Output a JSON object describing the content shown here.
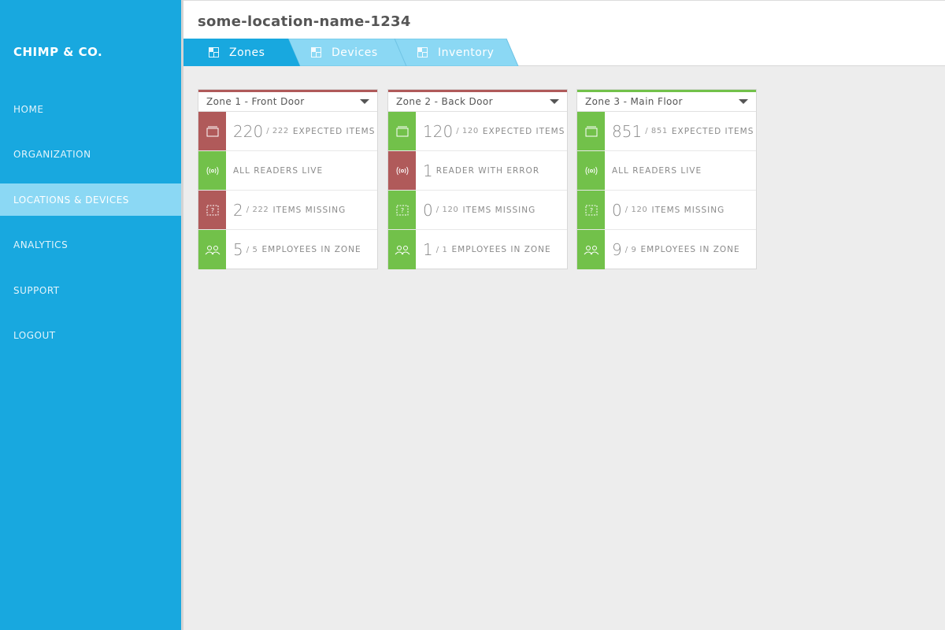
{
  "brand": "CHIMP & CO.",
  "nav": [
    {
      "label": "HOME",
      "active": false
    },
    {
      "label": "ORGANIZATION",
      "active": false
    },
    {
      "label": "LOCATIONS & DEVICES",
      "active": true
    },
    {
      "label": "ANALYTICS",
      "active": false
    },
    {
      "label": "SUPPORT",
      "active": false
    },
    {
      "label": "LOGOUT",
      "active": false
    }
  ],
  "page_title": "some-location-name-1234",
  "tabs": [
    {
      "label": "Zones",
      "active": true
    },
    {
      "label": "Devices",
      "active": false
    },
    {
      "label": "Inventory",
      "active": false
    }
  ],
  "colors": {
    "sidebar": "#18a8df",
    "active_nav": "#8bd8f4",
    "red": "#b05a5a",
    "green": "#72c14a"
  },
  "zones": [
    {
      "name": "Zone 1 - Front Door",
      "status": "red",
      "items": {
        "count": "220",
        "total": "/ 222",
        "label": "EXPECTED ITEMS",
        "status": "red"
      },
      "readers": {
        "count": "",
        "label": "ALL READERS LIVE",
        "status": "green"
      },
      "missing": {
        "count": "2",
        "total": "/ 222",
        "label": "ITEMS MISSING",
        "status": "red"
      },
      "employees": {
        "count": "5",
        "total": "/ 5",
        "label": "EMPLOYEES IN ZONE",
        "status": "green"
      }
    },
    {
      "name": "Zone 2 - Back Door",
      "status": "red",
      "items": {
        "count": "120",
        "total": "/ 120",
        "label": "EXPECTED ITEMS",
        "status": "green"
      },
      "readers": {
        "count": "1",
        "label": "READER WITH ERROR",
        "status": "red"
      },
      "missing": {
        "count": "0",
        "total": "/ 120",
        "label": "ITEMS MISSING",
        "status": "green"
      },
      "employees": {
        "count": "1",
        "total": "/ 1",
        "label": "EMPLOYEES IN ZONE",
        "status": "green"
      }
    },
    {
      "name": "Zone 3 - Main Floor",
      "status": "green",
      "items": {
        "count": "851",
        "total": "/ 851",
        "label": "EXPECTED ITEMS",
        "status": "green"
      },
      "readers": {
        "count": "",
        "label": "ALL READERS LIVE",
        "status": "green"
      },
      "missing": {
        "count": "0",
        "total": "/ 120",
        "label": "ITEMS MISSING",
        "status": "green"
      },
      "employees": {
        "count": "9",
        "total": "/ 9",
        "label": "EMPLOYEES IN ZONE",
        "status": "green"
      }
    }
  ]
}
